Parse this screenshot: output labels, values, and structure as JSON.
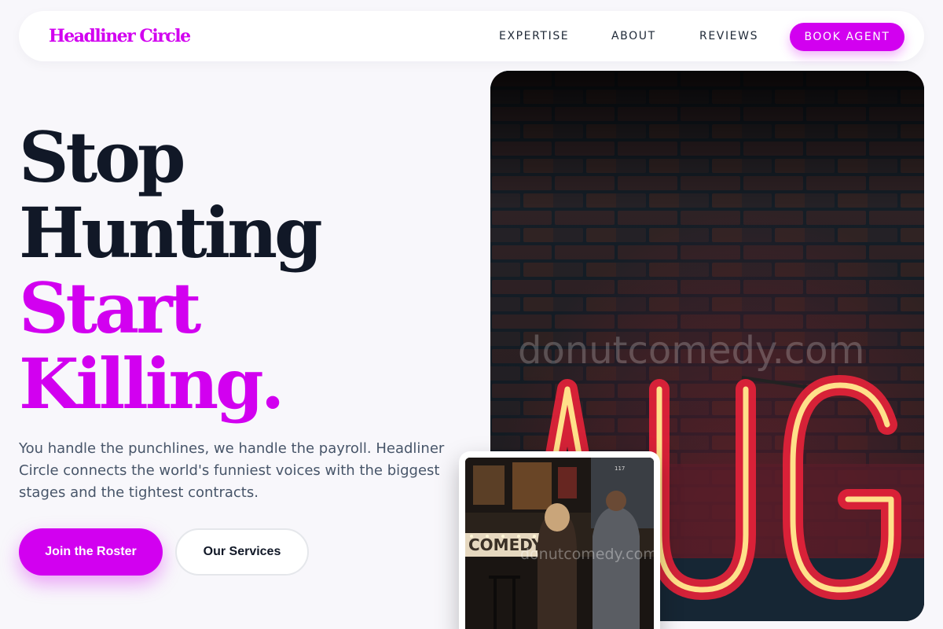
{
  "brand": {
    "name": "Headliner Circle",
    "accent_color": "#d200f0"
  },
  "nav": {
    "links": [
      "EXPERTISE",
      "ABOUT",
      "REVIEWS"
    ],
    "cta_label": "BOOK AGENT"
  },
  "hero": {
    "headline_line1": "Stop",
    "headline_line2": "Hunting",
    "headline_line3": "Start",
    "headline_line4": "Killing.",
    "subtitle": "You handle the punchlines, we handle the payroll. Headliner Circle connects the world's funniest voices with the biggest stages and the tightest contracts.",
    "primary_cta": "Join the Roster",
    "secondary_cta": "Our Services"
  },
  "images": {
    "main_watermark": "donutcomedy.com",
    "neon_sign_text": "AUG",
    "inset_watermark": "donutcomedy.com",
    "inset_sign_text": "COMEDY",
    "inset_door_number": "117"
  }
}
